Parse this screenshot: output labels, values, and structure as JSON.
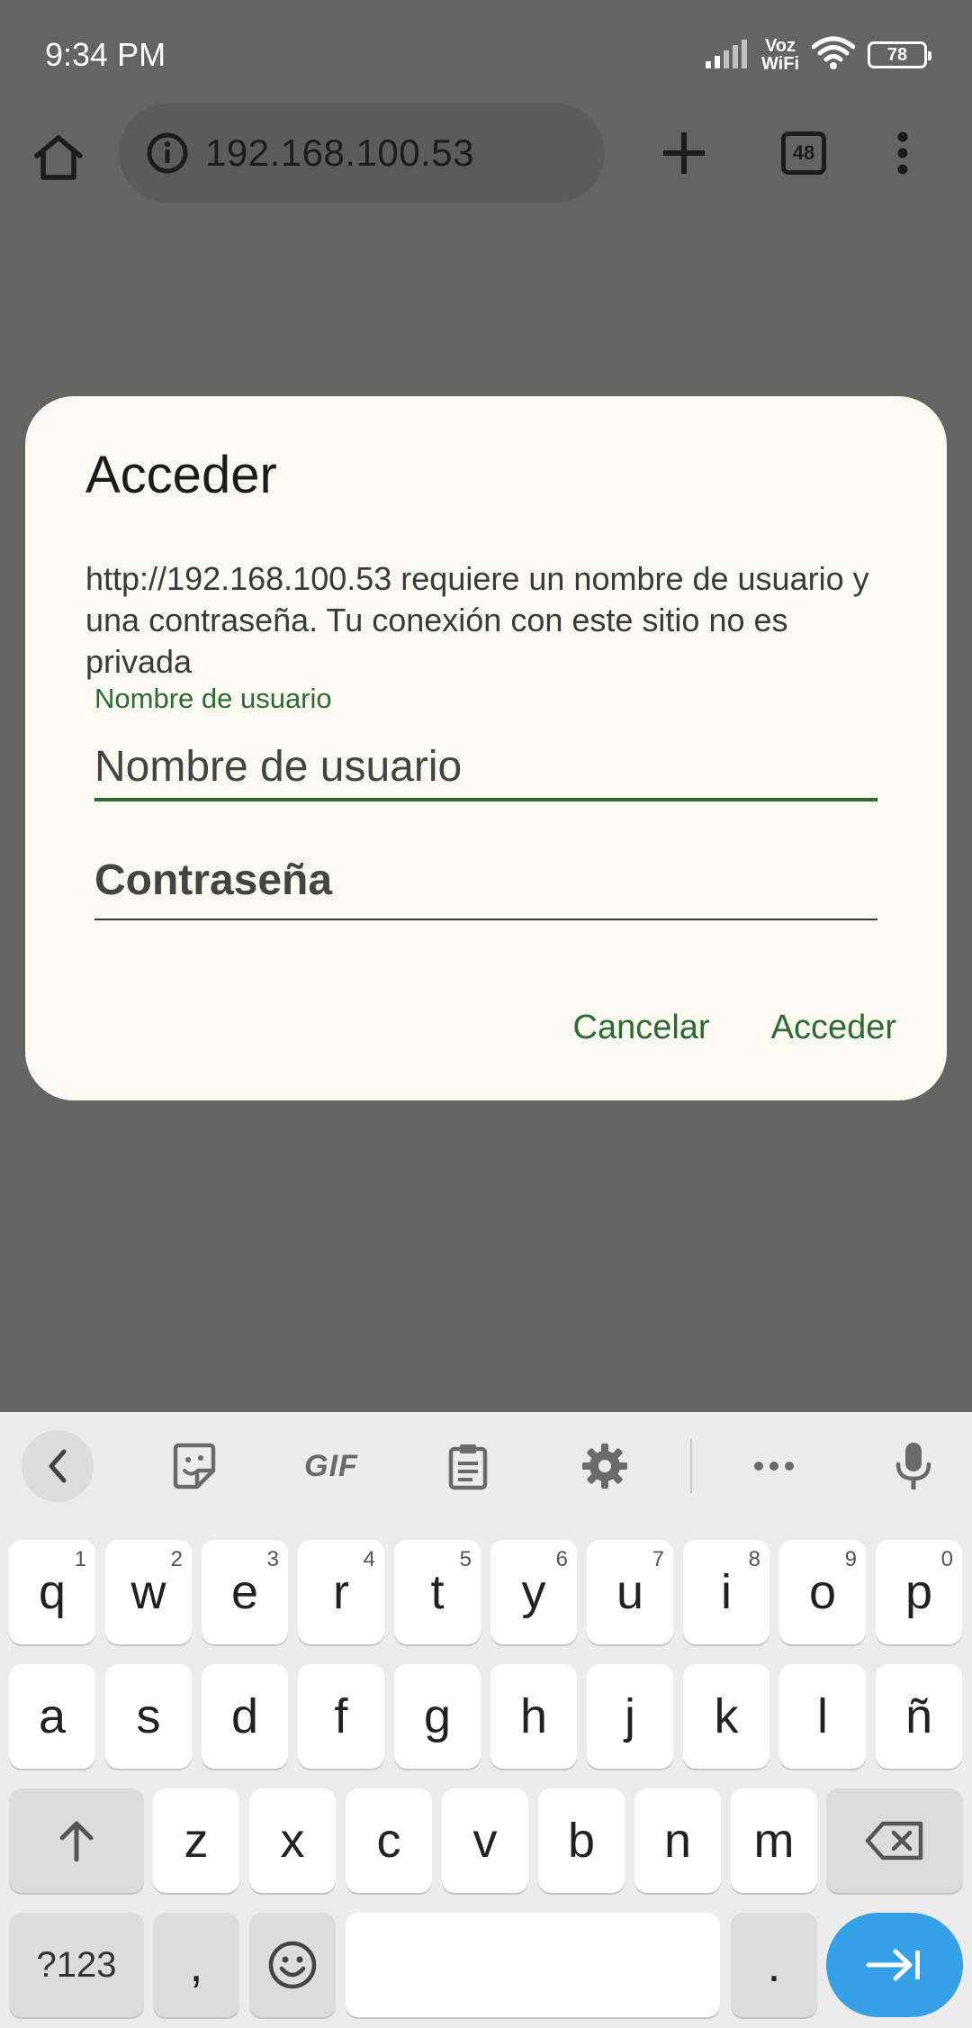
{
  "status_bar": {
    "time": "9:34 PM",
    "voz_line1": "Voz",
    "voz_line2": "WiFi",
    "battery": "78"
  },
  "browser": {
    "url": "192.168.100.53",
    "tab_count": "48"
  },
  "dialog": {
    "title": "Acceder",
    "message": "http://192.168.100.53 requiere un nombre de usuario y una contraseña. Tu conexión con este sitio no es privada",
    "username_label": "Nombre de usuario",
    "username_placeholder": "Nombre de usuario",
    "username_value": "",
    "password_placeholder": "Contraseña",
    "password_value": "",
    "cancel_label": "Cancelar",
    "submit_label": "Acceder"
  },
  "keyboard": {
    "gif_label": "GIF",
    "row1": [
      {
        "key": "q",
        "hint": "1"
      },
      {
        "key": "w",
        "hint": "2"
      },
      {
        "key": "e",
        "hint": "3"
      },
      {
        "key": "r",
        "hint": "4"
      },
      {
        "key": "t",
        "hint": "5"
      },
      {
        "key": "y",
        "hint": "6"
      },
      {
        "key": "u",
        "hint": "7"
      },
      {
        "key": "i",
        "hint": "8"
      },
      {
        "key": "o",
        "hint": "9"
      },
      {
        "key": "p",
        "hint": "0"
      }
    ],
    "row2": [
      "a",
      "s",
      "d",
      "f",
      "g",
      "h",
      "j",
      "k",
      "l",
      "ñ"
    ],
    "row3": [
      "z",
      "x",
      "c",
      "v",
      "b",
      "n",
      "m"
    ],
    "symbols_label": "?123",
    "comma": ",",
    "period": "."
  },
  "colors": {
    "accent_green": "#2e6b32",
    "scrim": "#646464",
    "enter_key": "#35a0e6"
  }
}
